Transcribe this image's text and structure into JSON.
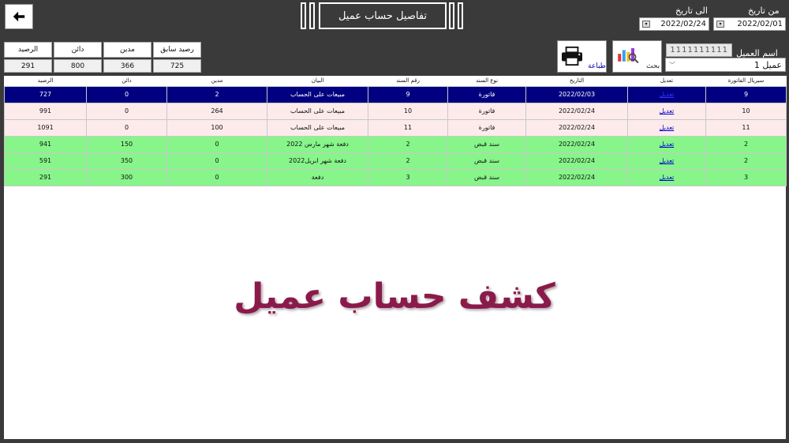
{
  "header": {
    "title": "تفاصيل حساب عميل"
  },
  "filters": {
    "from_label": "من تاريخ",
    "from_value": "2022/02/01",
    "to_label": "الى تاريخ",
    "to_value": "2022/02/24"
  },
  "customer": {
    "label": "اسم العميل",
    "code": "1111111111",
    "selected": "عميل 1"
  },
  "actions": {
    "search_label": "بحث",
    "print_label": "طباعة"
  },
  "summary": {
    "prev_label": "رصيد سابق",
    "prev_value": "725",
    "debit_label": "مدين",
    "debit_value": "366",
    "credit_label": "دائن",
    "credit_value": "800",
    "balance_label": "الرصيد",
    "balance_value": "291"
  },
  "table": {
    "headers": [
      "سيريال الفاتورة",
      "تعديل",
      "التاريخ",
      "نوع السند",
      "رقم السند",
      "البيان",
      "مدين",
      "دائن",
      "الرصيد"
    ],
    "rows": [
      [
        "9",
        "تعديل",
        "2022/02/03",
        "فاتورة",
        "9",
        "مبيعات على الحساب",
        "2",
        "0",
        "727"
      ],
      [
        "10",
        "تعديل",
        "2022/02/24",
        "فاتورة",
        "10",
        "مبيعات على الحساب",
        "264",
        "0",
        "991"
      ],
      [
        "11",
        "تعديل",
        "2022/02/24",
        "فاتورة",
        "11",
        "مبيعات على الحساب",
        "100",
        "0",
        "1091"
      ],
      [
        "2",
        "تعديل",
        "2022/02/24",
        "سند قبض",
        "2",
        "دفعة شهر مارس 2022",
        "0",
        "150",
        "941"
      ],
      [
        "2",
        "تعديل",
        "2022/02/24",
        "سند قبض",
        "2",
        "دفعة شهر ابريل2022",
        "0",
        "350",
        "591"
      ],
      [
        "3",
        "تعديل",
        "2022/02/24",
        "سند قبض",
        "3",
        "دفعة",
        "0",
        "300",
        "291"
      ]
    ]
  },
  "watermark": "كشف حساب عميل",
  "colors": {
    "selected_row": "#000080",
    "invoice_row": "#fdebeb",
    "receipt_row": "#87f58a",
    "watermark": "#8a1a4a"
  }
}
